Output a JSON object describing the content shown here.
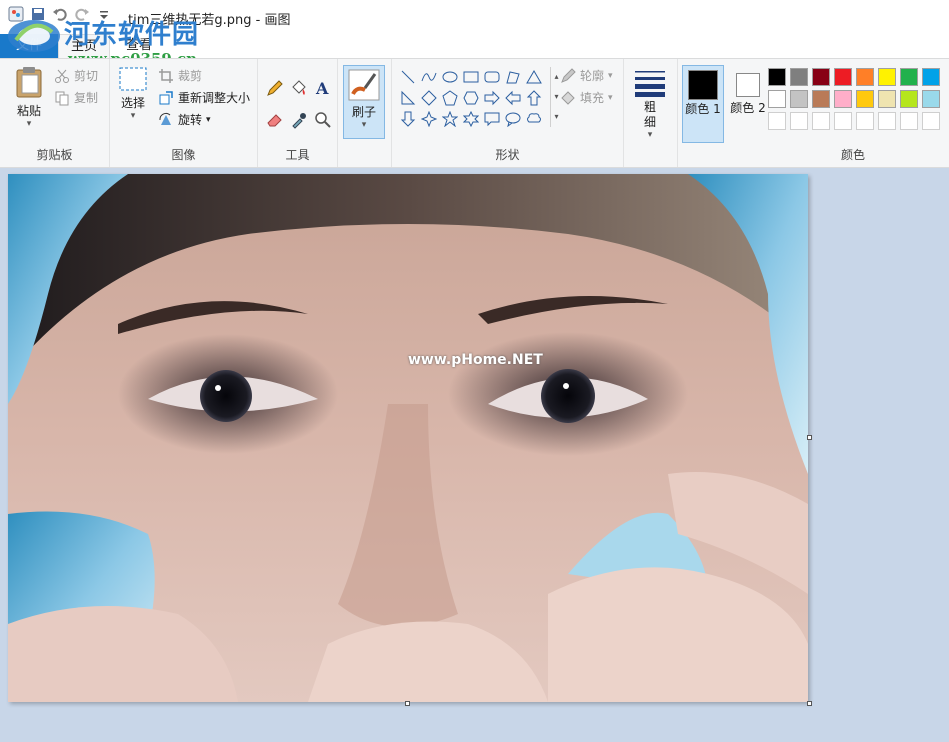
{
  "window": {
    "title": "tim三维热无若g.png - 画图"
  },
  "watermark": {
    "site_name": "河东软件园",
    "site_url": "www.pc0359.cn",
    "photo_mark": "www.pHome.NET"
  },
  "tabs": {
    "file": "文件",
    "home": "主页",
    "view": "查看"
  },
  "clipboard": {
    "paste": "粘贴",
    "cut": "剪切",
    "copy": "复制",
    "label": "剪贴板"
  },
  "image": {
    "select": "选择",
    "crop": "裁剪",
    "resize": "重新调整大小",
    "rotate": "旋转",
    "label": "图像"
  },
  "tools": {
    "label": "工具"
  },
  "brushes": {
    "label": "刷子"
  },
  "shapes": {
    "outline": "轮廓",
    "fill": "填充",
    "label": "形状"
  },
  "size": {
    "label": "粗细"
  },
  "colors": {
    "color1": "颜色 1",
    "color2": "颜色 2",
    "label": "颜色",
    "color1_value": "#000000",
    "color2_value": "#ffffff",
    "palette": [
      "#000000",
      "#7f7f7f",
      "#880015",
      "#ed1c24",
      "#ff7f27",
      "#fff200",
      "#22b14c",
      "#00a2e8",
      "#ffffff",
      "#c3c3c3",
      "#b97a57",
      "#ffaec9",
      "#ffc90e",
      "#efe4b0",
      "#b5e61d",
      "#99d9ea"
    ],
    "accent": "#1979ca"
  }
}
